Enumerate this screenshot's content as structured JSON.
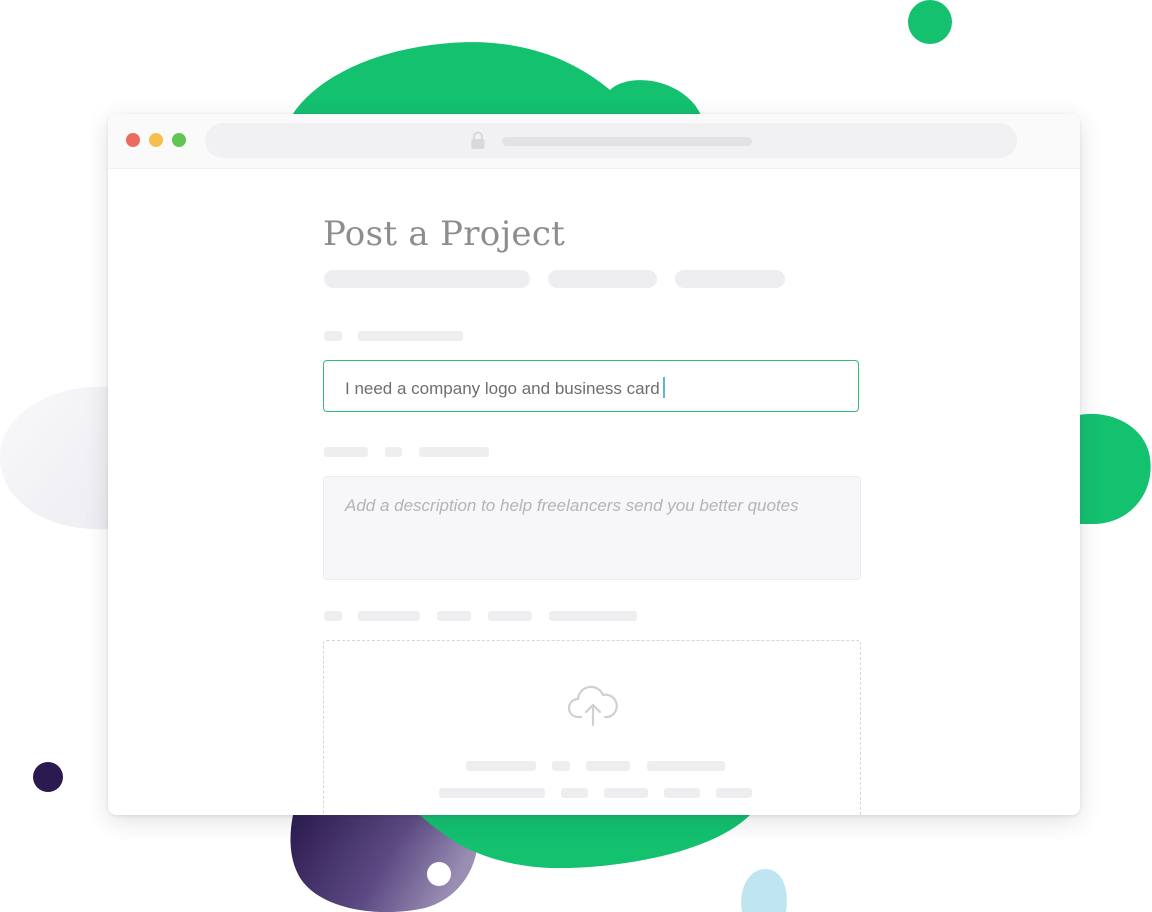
{
  "colors": {
    "accent_green": "#2fbf71",
    "blob_green": "#13c16f",
    "blob_purple": "#3a2462",
    "blob_light_blue": "#bfe6f0",
    "traffic_red": "#ec6a5e",
    "traffic_yellow": "#f4bf4f",
    "traffic_green": "#61c554"
  },
  "browser": {
    "traffic_lights": [
      "close",
      "minimize",
      "zoom"
    ],
    "address_icon": "lock-icon"
  },
  "form": {
    "title": "Post a Project",
    "project_name_value": "I need a company logo and business card",
    "description_placeholder": "Add a description to help freelancers send you better quotes",
    "upload_icon": "cloud-upload-icon"
  }
}
